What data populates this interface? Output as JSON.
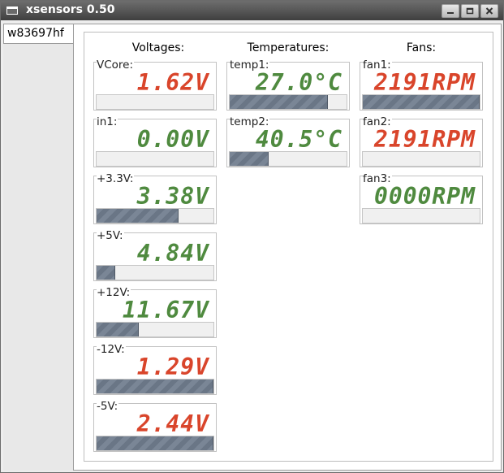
{
  "window": {
    "title": "xsensors 0.50"
  },
  "tabs": [
    "w83697hf"
  ],
  "columns": {
    "voltages": "Voltages:",
    "temperatures": "Temperatures:",
    "fans": "Fans:"
  },
  "colors": {
    "ok": "#4f8a3f",
    "alarm": "#d9452b",
    "bar": "#7a8696"
  },
  "voltages": [
    {
      "label": "VCore:",
      "value": "1.62V",
      "state": "alarm",
      "level": 0
    },
    {
      "label": "in1:",
      "value": "0.00V",
      "state": "ok",
      "level": 0
    },
    {
      "label": "+3.3V:",
      "value": "3.38V",
      "state": "ok",
      "level": 0.7
    },
    {
      "label": "+5V:",
      "value": "4.84V",
      "state": "ok",
      "level": 0.16
    },
    {
      "label": "+12V:",
      "value": "11.67V",
      "state": "ok",
      "level": 0.36
    },
    {
      "label": "-12V:",
      "value": "1.29V",
      "state": "alarm",
      "level": 1.0
    },
    {
      "label": "-5V:",
      "value": "2.44V",
      "state": "alarm",
      "level": 1.0
    }
  ],
  "temperatures": [
    {
      "label": "temp1:",
      "value": "27.0°C",
      "state": "ok",
      "level": 0.84
    },
    {
      "label": "temp2:",
      "value": "40.5°C",
      "state": "ok",
      "level": 0.33
    }
  ],
  "fans": [
    {
      "label": "fan1:",
      "value": "2191RPM",
      "state": "alarm",
      "level": 1.0
    },
    {
      "label": "fan2:",
      "value": "2191RPM",
      "state": "alarm",
      "level": 0
    },
    {
      "label": "fan3:",
      "value": "0000RPM",
      "state": "ok",
      "level": 0
    }
  ]
}
